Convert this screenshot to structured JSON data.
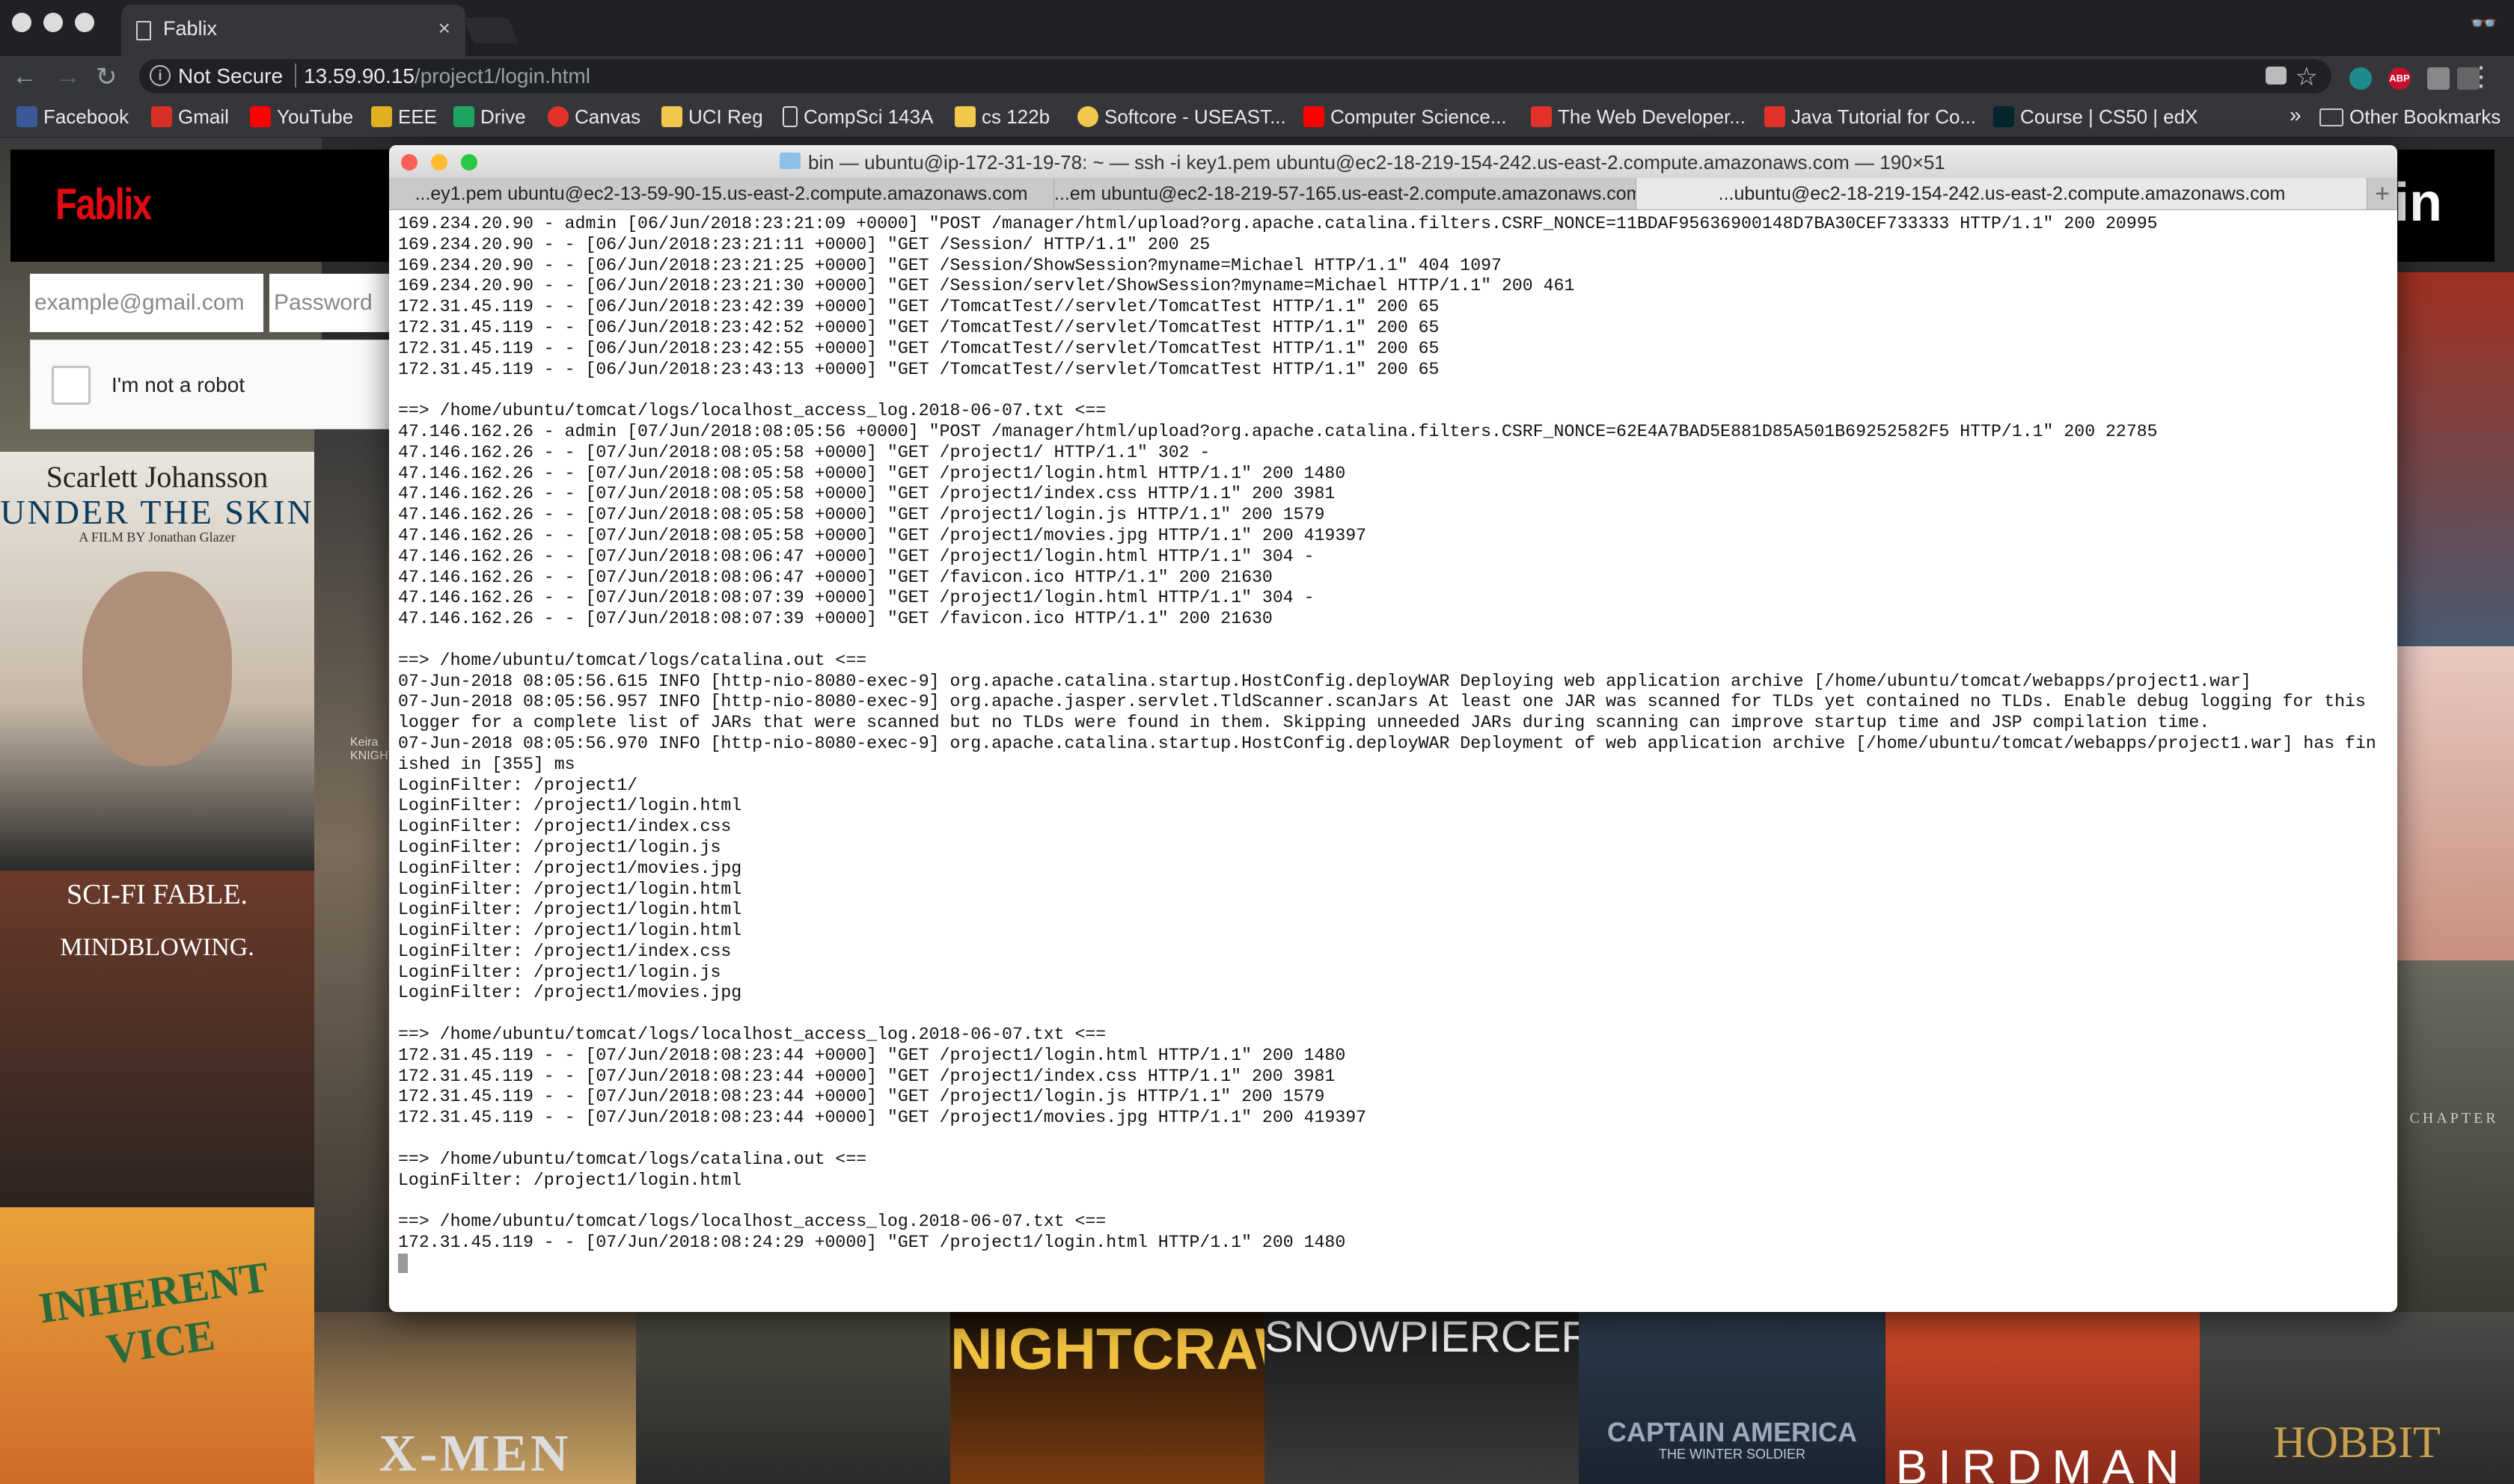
{
  "browser": {
    "tab_title": "Fablix",
    "tab_close": "×",
    "url_secure_label": "Not Secure",
    "url_host": "13.59.90.15",
    "url_path": "/project1/login.html",
    "bookmarks": [
      {
        "label": "Facebook",
        "color": "#3b5998"
      },
      {
        "label": "Gmail",
        "color": "#d93025"
      },
      {
        "label": "YouTube",
        "color": "#ff0000"
      },
      {
        "label": "EEE",
        "color": "#e0b020"
      },
      {
        "label": "Drive",
        "color": "#1fa463"
      },
      {
        "label": "Canvas",
        "color": "#e4322b"
      },
      {
        "label": "UCI Reg",
        "color": "#f2c94c"
      },
      {
        "label": "CompSci 143A",
        "color": "#dddddd"
      },
      {
        "label": "cs 122b",
        "color": "#f2c94c"
      },
      {
        "label": "Softcore - USEAST...",
        "color": "#f2c94c"
      },
      {
        "label": "Computer Science...",
        "color": "#ff0000"
      },
      {
        "label": "The Web Developer...",
        "color": "#e4322b"
      },
      {
        "label": "Java Tutorial for Co...",
        "color": "#e4322b"
      },
      {
        "label": "Course | CS50 | edX",
        "color": "#02262b"
      }
    ],
    "bookmarks_more": "»",
    "other_bookmarks": "Other Bookmarks"
  },
  "page": {
    "logo": "Fablix",
    "header_right": "ogin",
    "email_placeholder": "example@gmail.com",
    "password_placeholder": "Password",
    "captcha_label": "I'm not a robot",
    "posters": {
      "scarlett": "Scarlett Johansson",
      "under_the_skin": "UNDER THE SKIN",
      "a_film_by": "A FILM BY Jonathan Glazer",
      "scifi_fable": "SCI-FI FABLE.",
      "mindblowing": "MINDBLOWING.",
      "inherent_vice": "INHERENT VICE",
      "xmen": "X-MEN",
      "nightcrawler": "NIGHTCRAWLER",
      "snowpiercer": "SNOWPIERCER",
      "captain_america": "CAPTAIN AMERICA",
      "winter_soldier": "THE WINTER SOLDIER",
      "birdman": "BIRDMAN",
      "hobbit": "HOBBIT",
      "chapter": "CHAPTER",
      "keira": "Keira KNIGHTL"
    }
  },
  "terminal": {
    "title": "bin — ubuntu@ip-172-31-19-78: ~ — ssh -i key1.pem ubuntu@ec2-18-219-154-242.us-east-2.compute.amazonaws.com — 190×51",
    "tabs": [
      "...ey1.pem ubuntu@ec2-13-59-90-15.us-east-2.compute.amazonaws.com",
      "...em ubuntu@ec2-18-219-57-165.us-east-2.compute.amazonaws.com",
      "...ubuntu@ec2-18-219-154-242.us-east-2.compute.amazonaws.com"
    ],
    "tab_add": "+",
    "lines": [
      "169.234.20.90 - admin [06/Jun/2018:23:21:09 +0000] \"POST /manager/html/upload?org.apache.catalina.filters.CSRF_NONCE=11BDAF95636900148D7BA30CEF733333 HTTP/1.1\" 200 20995",
      "169.234.20.90 - - [06/Jun/2018:23:21:11 +0000] \"GET /Session/ HTTP/1.1\" 200 25",
      "169.234.20.90 - - [06/Jun/2018:23:21:25 +0000] \"GET /Session/ShowSession?myname=Michael HTTP/1.1\" 404 1097",
      "169.234.20.90 - - [06/Jun/2018:23:21:30 +0000] \"GET /Session/servlet/ShowSession?myname=Michael HTTP/1.1\" 200 461",
      "172.31.45.119 - - [06/Jun/2018:23:42:39 +0000] \"GET /TomcatTest//servlet/TomcatTest HTTP/1.1\" 200 65",
      "172.31.45.119 - - [06/Jun/2018:23:42:52 +0000] \"GET /TomcatTest//servlet/TomcatTest HTTP/1.1\" 200 65",
      "172.31.45.119 - - [06/Jun/2018:23:42:55 +0000] \"GET /TomcatTest//servlet/TomcatTest HTTP/1.1\" 200 65",
      "172.31.45.119 - - [06/Jun/2018:23:43:13 +0000] \"GET /TomcatTest//servlet/TomcatTest HTTP/1.1\" 200 65",
      "",
      "==> /home/ubuntu/tomcat/logs/localhost_access_log.2018-06-07.txt <==",
      "47.146.162.26 - admin [07/Jun/2018:08:05:56 +0000] \"POST /manager/html/upload?org.apache.catalina.filters.CSRF_NONCE=62E4A7BAD5E881D85A501B69252582F5 HTTP/1.1\" 200 22785",
      "47.146.162.26 - - [07/Jun/2018:08:05:58 +0000] \"GET /project1/ HTTP/1.1\" 302 -",
      "47.146.162.26 - - [07/Jun/2018:08:05:58 +0000] \"GET /project1/login.html HTTP/1.1\" 200 1480",
      "47.146.162.26 - - [07/Jun/2018:08:05:58 +0000] \"GET /project1/index.css HTTP/1.1\" 200 3981",
      "47.146.162.26 - - [07/Jun/2018:08:05:58 +0000] \"GET /project1/login.js HTTP/1.1\" 200 1579",
      "47.146.162.26 - - [07/Jun/2018:08:05:58 +0000] \"GET /project1/movies.jpg HTTP/1.1\" 200 419397",
      "47.146.162.26 - - [07/Jun/2018:08:06:47 +0000] \"GET /project1/login.html HTTP/1.1\" 304 -",
      "47.146.162.26 - - [07/Jun/2018:08:06:47 +0000] \"GET /favicon.ico HTTP/1.1\" 200 21630",
      "47.146.162.26 - - [07/Jun/2018:08:07:39 +0000] \"GET /project1/login.html HTTP/1.1\" 304 -",
      "47.146.162.26 - - [07/Jun/2018:08:07:39 +0000] \"GET /favicon.ico HTTP/1.1\" 200 21630",
      "",
      "==> /home/ubuntu/tomcat/logs/catalina.out <==",
      "07-Jun-2018 08:05:56.615 INFO [http-nio-8080-exec-9] org.apache.catalina.startup.HostConfig.deployWAR Deploying web application archive [/home/ubuntu/tomcat/webapps/project1.war]",
      "07-Jun-2018 08:05:56.957 INFO [http-nio-8080-exec-9] org.apache.jasper.servlet.TldScanner.scanJars At least one JAR was scanned for TLDs yet contained no TLDs. Enable debug logging for this",
      "logger for a complete list of JARs that were scanned but no TLDs were found in them. Skipping unneeded JARs during scanning can improve startup time and JSP compilation time.",
      "07-Jun-2018 08:05:56.970 INFO [http-nio-8080-exec-9] org.apache.catalina.startup.HostConfig.deployWAR Deployment of web application archive [/home/ubuntu/tomcat/webapps/project1.war] has fin",
      "ished in [355] ms",
      "LoginFilter: /project1/",
      "LoginFilter: /project1/login.html",
      "LoginFilter: /project1/index.css",
      "LoginFilter: /project1/login.js",
      "LoginFilter: /project1/movies.jpg",
      "LoginFilter: /project1/login.html",
      "LoginFilter: /project1/login.html",
      "LoginFilter: /project1/login.html",
      "LoginFilter: /project1/index.css",
      "LoginFilter: /project1/login.js",
      "LoginFilter: /project1/movies.jpg",
      "",
      "==> /home/ubuntu/tomcat/logs/localhost_access_log.2018-06-07.txt <==",
      "172.31.45.119 - - [07/Jun/2018:08:23:44 +0000] \"GET /project1/login.html HTTP/1.1\" 200 1480",
      "172.31.45.119 - - [07/Jun/2018:08:23:44 +0000] \"GET /project1/index.css HTTP/1.1\" 200 3981",
      "172.31.45.119 - - [07/Jun/2018:08:23:44 +0000] \"GET /project1/login.js HTTP/1.1\" 200 1579",
      "172.31.45.119 - - [07/Jun/2018:08:23:44 +0000] \"GET /project1/movies.jpg HTTP/1.1\" 200 419397",
      "",
      "==> /home/ubuntu/tomcat/logs/catalina.out <==",
      "LoginFilter: /project1/login.html",
      "",
      "==> /home/ubuntu/tomcat/logs/localhost_access_log.2018-06-07.txt <==",
      "172.31.45.119 - - [07/Jun/2018:08:24:29 +0000] \"GET /project1/login.html HTTP/1.1\" 200 1480"
    ]
  }
}
